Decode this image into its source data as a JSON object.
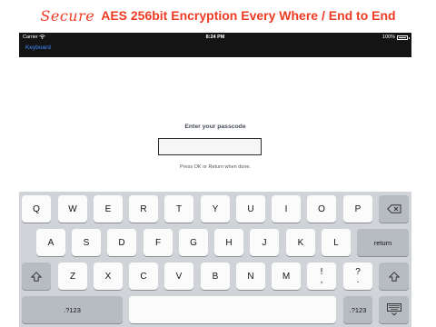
{
  "banner": {
    "script_word": "Secure",
    "headline": "AES 256bit Encryption Every Where / End to End",
    "accent_color": "#ee3b24"
  },
  "status_bar": {
    "carrier": "Carrier",
    "time": "8:24 PM",
    "battery": "100%"
  },
  "nav": {
    "back_label": "Keyboard",
    "back_color": "#3b8cff"
  },
  "passcode": {
    "prompt": "Enter your passcode",
    "value": "",
    "hint": "Press OK or Return when done."
  },
  "keyboard": {
    "row1": [
      "Q",
      "W",
      "E",
      "R",
      "T",
      "Y",
      "U",
      "I",
      "O",
      "P"
    ],
    "row2": [
      "A",
      "S",
      "D",
      "F",
      "G",
      "H",
      "J",
      "K",
      "L"
    ],
    "row3": [
      "Z",
      "X",
      "C",
      "V",
      "B",
      "N",
      "M"
    ],
    "punct": [
      {
        "top": "!",
        "bottom": ","
      },
      {
        "top": "?",
        "bottom": "."
      }
    ],
    "return_label": "return",
    "numbers_label": ".?123",
    "icons": {
      "backspace": "backspace-icon",
      "shift": "shift-icon",
      "hide_keyboard": "keyboard-hide-icon",
      "wifi": "wifi-icon",
      "battery": "battery-icon"
    }
  }
}
